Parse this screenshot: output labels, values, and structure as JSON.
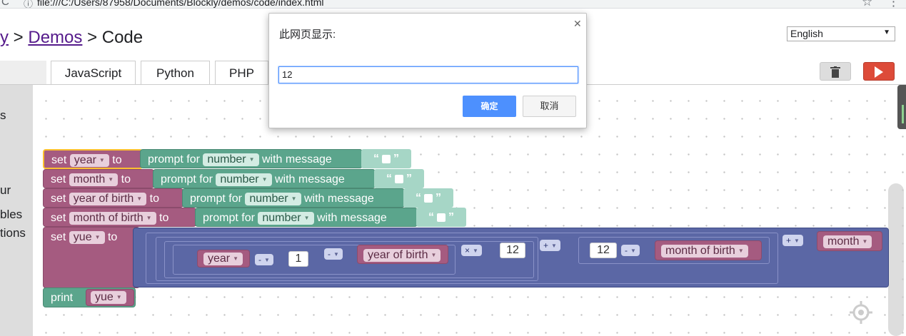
{
  "browser": {
    "url": "file:///C:/Users/87958/Documents/Blockly/demos/code/index.html",
    "info_icon": "info-icon",
    "reload_glyph": "C"
  },
  "header": {
    "crumb_1": "y",
    "sep_1": ">",
    "crumb_2": "Demos",
    "sep_2": ">",
    "crumb_3": "Code"
  },
  "language_select": {
    "value": "English"
  },
  "tabs": [
    {
      "label": "JavaScript"
    },
    {
      "label": "Python"
    },
    {
      "label": "PHP"
    }
  ],
  "toolbox": {
    "categories": [
      "s",
      "ur",
      "bles",
      "tions"
    ]
  },
  "dialog": {
    "title": "此网页显示:",
    "input_value": "12",
    "ok_label": "确定",
    "cancel_label": "取消"
  },
  "blocks": {
    "set_kw": "set",
    "to_kw": "to",
    "prompt_kw": "prompt for",
    "number_kw": "number",
    "with_message_kw": "with message",
    "print_kw": "print",
    "vars": {
      "year": "year",
      "month": "month",
      "year_of_birth": "year of birth",
      "month_of_birth": "month of birth",
      "yue": "yue"
    },
    "ops": {
      "minus": "-",
      "times": "×",
      "plus": "+"
    },
    "numbers": {
      "one": "1",
      "twelve_a": "12",
      "twelve_b": "12"
    },
    "quote_open": "“",
    "quote_close": "”"
  },
  "colors": {
    "variable_block": "#a55b80",
    "prompt_block": "#5ba58c",
    "math_block": "#5b67a5",
    "run_button": "#dd4b39",
    "selected_outline": "#fdc02f"
  }
}
